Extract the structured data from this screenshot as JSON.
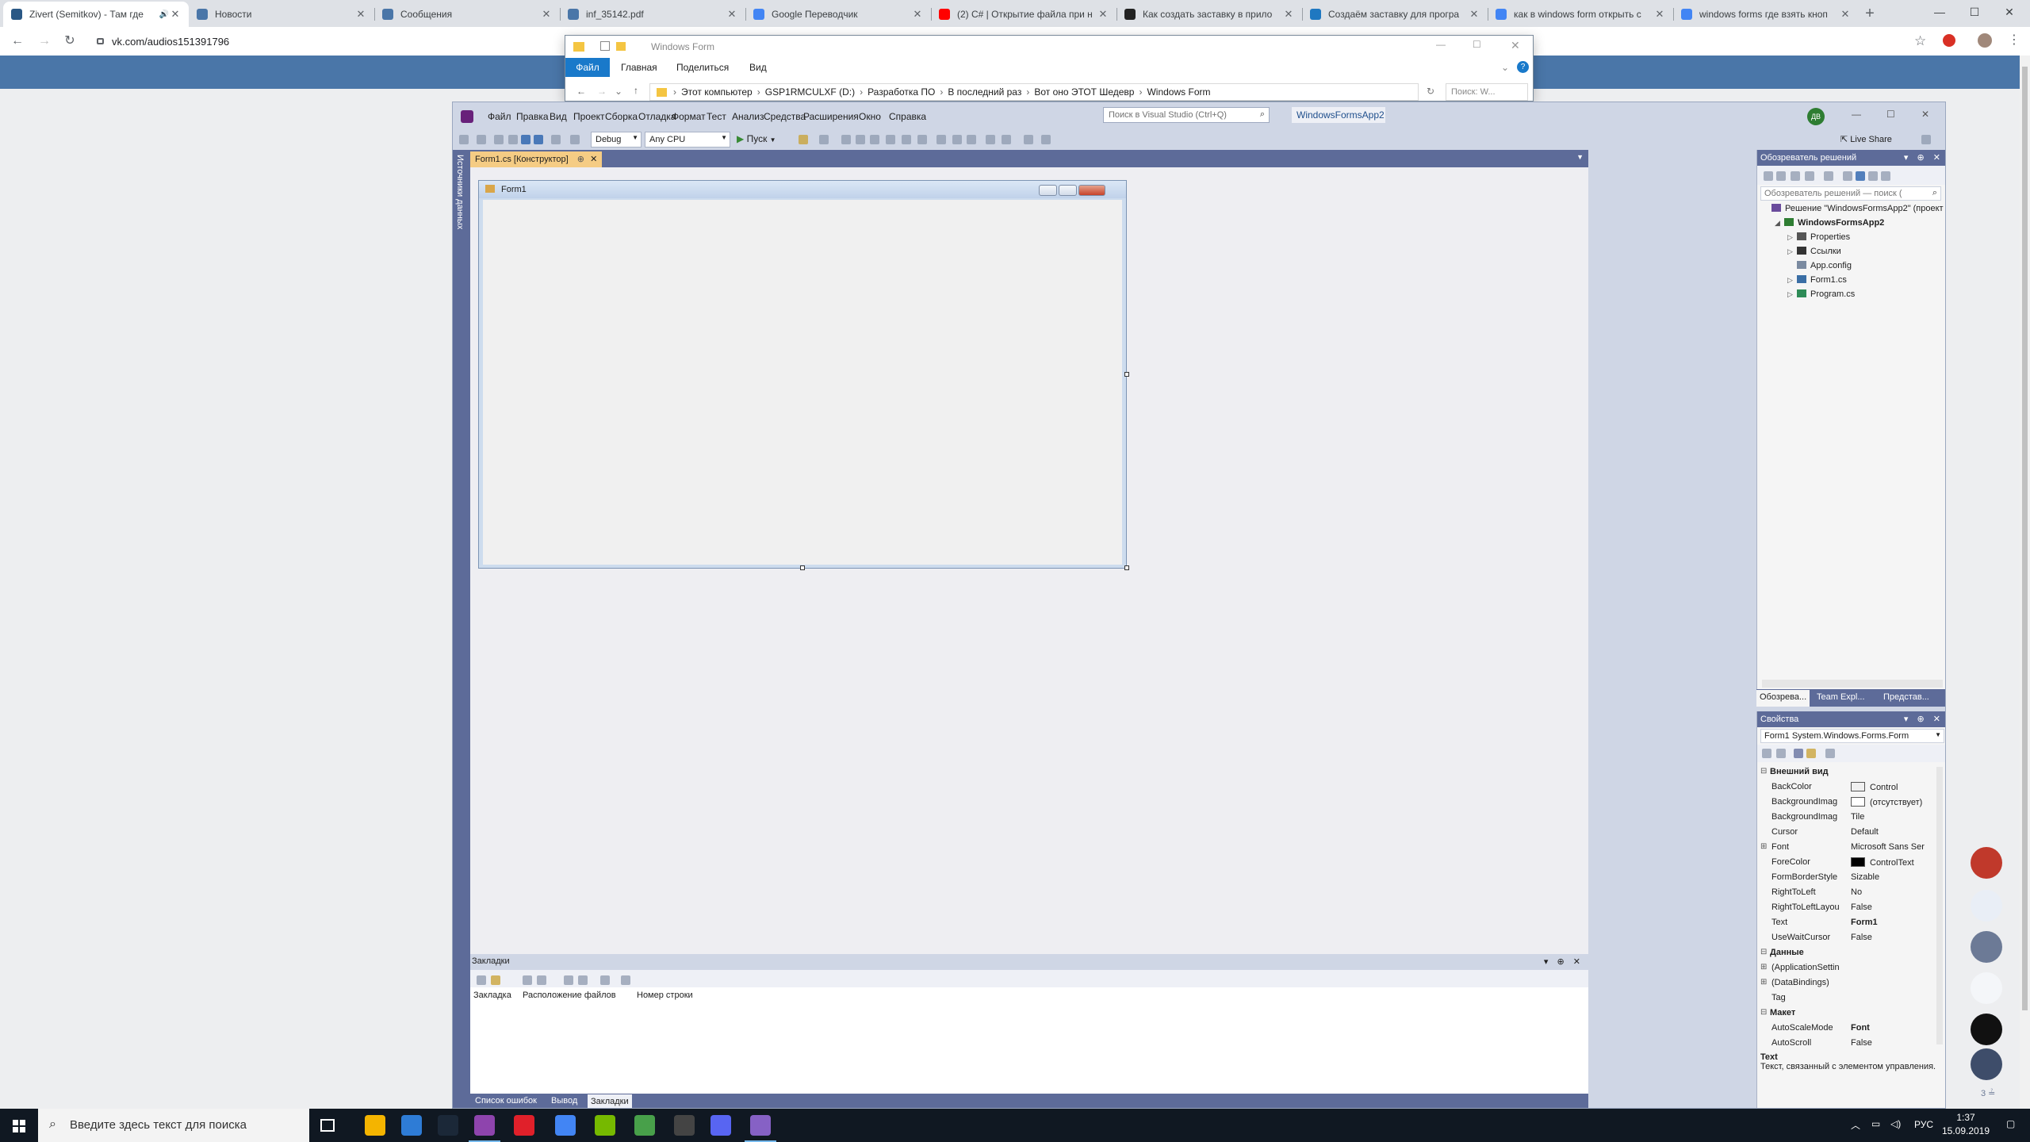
{
  "browser": {
    "tabs": [
      {
        "title": "Zivert (Semitkov) - Там где",
        "fav": "#2a5885",
        "active": true,
        "icon": "speaker-icon"
      },
      {
        "title": "Новости",
        "fav": "#4a76a8"
      },
      {
        "title": "Сообщения",
        "fav": "#4a76a8"
      },
      {
        "title": "inf_35142.pdf",
        "fav": "#4a76a8"
      },
      {
        "title": "Google Переводчик",
        "fav": "#4285f4"
      },
      {
        "title": "(2) C# | Открытие файла при н",
        "fav": "#ff0000"
      },
      {
        "title": "Как создать заставку в прило",
        "fav": "#222222"
      },
      {
        "title": "Создаём заставку для програ",
        "fav": "#1f78c1"
      },
      {
        "title": "как в windows form открыть с",
        "fav": "#4285f4"
      },
      {
        "title": "windows forms где взять кноп",
        "fav": "#4285f4"
      }
    ],
    "url": "vk.com/audios151391796"
  },
  "explorer": {
    "title": "Windows Form",
    "ribbon": [
      "Файл",
      "Главная",
      "Поделиться",
      "Вид"
    ],
    "path": [
      "Этот компьютер",
      "GSP1RMCULXF (D:)",
      "Разработка ПО",
      "В последний раз",
      "Вот оно ЭТОТ Шедевр",
      "Windows Form"
    ],
    "search_placeholder": "Поиск: W..."
  },
  "vs": {
    "menu": [
      "Файл",
      "Правка",
      "Вид",
      "Проект",
      "Сборка",
      "Отладка",
      "Формат",
      "Тест",
      "Анализ",
      "Средства",
      "Расширения",
      "Окно",
      "Справка"
    ],
    "search_placeholder": "Поиск в Visual Studio (Ctrl+Q)",
    "project": "WindowsFormsApp2",
    "user_initials": "ДВ",
    "live_share": "Live Share",
    "config": "Debug",
    "platform": "Any CPU",
    "run_label": "Пуск",
    "left_strip_label": "Источники данных",
    "doc_tab": "Form1.cs [Конструктор]",
    "form_title": "Form1",
    "bookmarks": {
      "title": "Закладки",
      "columns": [
        "Закладка",
        "Расположение файлов",
        "Номер строки"
      ],
      "bottom_tabs": [
        "Список ошибок",
        "Вывод",
        "Закладки"
      ]
    },
    "solution": {
      "title": "Обозреватель решений",
      "search": "Обозреватель решений — поиск (",
      "items": [
        {
          "label": "Решение \"WindowsFormsApp2\" (проект",
          "indent": 0,
          "tw": "",
          "bold": false,
          "icon": "#6a4c9c"
        },
        {
          "label": "WindowsFormsApp2",
          "indent": 1,
          "tw": "◢",
          "bold": true,
          "icon": "#2e7d32"
        },
        {
          "label": "Properties",
          "indent": 2,
          "tw": "▷",
          "bold": false,
          "icon": "#555555"
        },
        {
          "label": "Ссылки",
          "indent": 2,
          "tw": "▷",
          "bold": false,
          "icon": "#333333"
        },
        {
          "label": "App.config",
          "indent": 2,
          "tw": "",
          "bold": false,
          "icon": "#7a8aa0"
        },
        {
          "label": "Form1.cs",
          "indent": 2,
          "tw": "▷",
          "bold": false,
          "icon": "#3a6ea5"
        },
        {
          "label": "Program.cs",
          "indent": 2,
          "tw": "▷",
          "bold": false,
          "icon": "#2e8b57"
        }
      ],
      "tabs": [
        "Обозрева...",
        "Team Expl...",
        "Представ..."
      ]
    },
    "properties": {
      "title": "Свойства",
      "object": "Form1  System.Windows.Forms.Form",
      "rows": [
        {
          "cat": true,
          "name": "Внешний вид",
          "value": ""
        },
        {
          "name": "BackColor",
          "value": "Control",
          "swatch": "#f0f0f0"
        },
        {
          "name": "BackgroundImag",
          "value": "(отсутствует)",
          "swatch": "#ffffff"
        },
        {
          "name": "BackgroundImag",
          "value": "Tile"
        },
        {
          "name": "Cursor",
          "value": "Default"
        },
        {
          "name": "Font",
          "value": "Microsoft Sans Ser",
          "exp": "⊞"
        },
        {
          "name": "ForeColor",
          "value": "ControlText",
          "swatch": "#000000"
        },
        {
          "name": "FormBorderStyle",
          "value": "Sizable"
        },
        {
          "name": "RightToLeft",
          "value": "No"
        },
        {
          "name": "RightToLeftLayou",
          "value": "False"
        },
        {
          "name": "Text",
          "value": "Form1",
          "bold": true
        },
        {
          "name": "UseWaitCursor",
          "value": "False"
        },
        {
          "cat": true,
          "name": "Данные",
          "value": ""
        },
        {
          "name": "(ApplicationSettin",
          "value": "",
          "exp": "⊞"
        },
        {
          "name": "(DataBindings)",
          "value": "",
          "exp": "⊞"
        },
        {
          "name": "Tag",
          "value": ""
        },
        {
          "cat": true,
          "name": "Макет",
          "value": ""
        },
        {
          "name": "AutoScaleMode",
          "value": "Font",
          "bold": true
        },
        {
          "name": "AutoScroll",
          "value": "False"
        }
      ],
      "desc_title": "Text",
      "desc_text": "Текст, связанный с элементом управления."
    }
  },
  "taskbar": {
    "search_placeholder": "Введите здесь текст для поиска",
    "apps": [
      "#f4b400",
      "#2e7cd6",
      "#1b2838",
      "#8e44ad",
      "#e0202a",
      "#4285f4",
      "#76b900",
      "#48a04a",
      "#444444",
      "#5865f2",
      "#8661c5"
    ],
    "time": "1:37",
    "date": "15.09.2019",
    "lang": "РУС"
  }
}
